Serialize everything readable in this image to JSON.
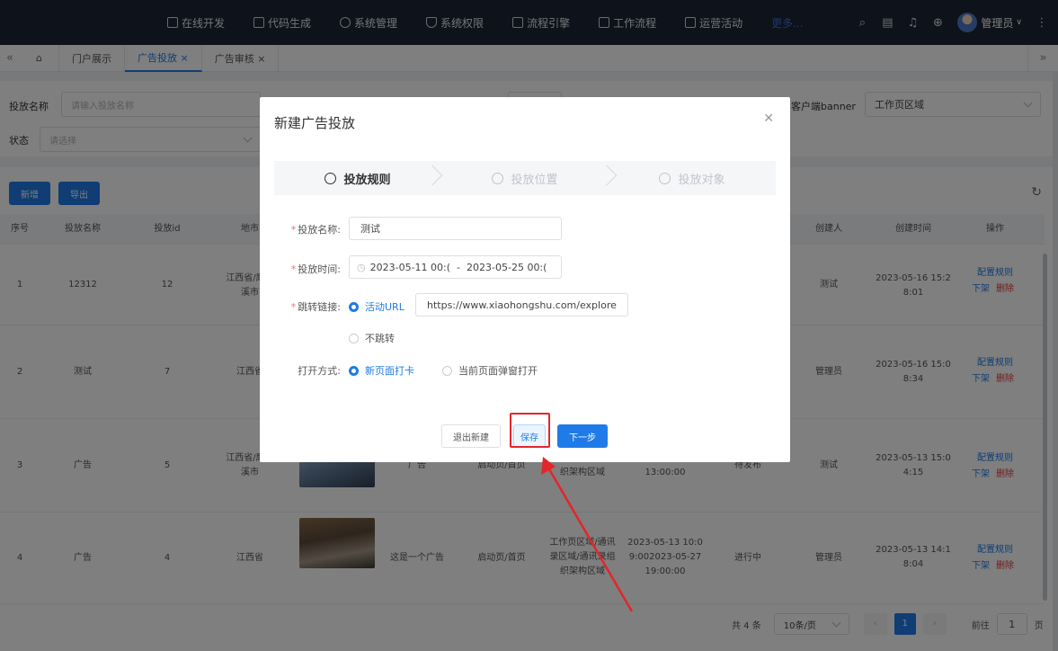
{
  "topnav": {
    "menu": [
      {
        "label": "在线开发",
        "icon": "monitor-icon"
      },
      {
        "label": "代码生成",
        "icon": "code-icon"
      },
      {
        "label": "系统管理",
        "icon": "gear-icon"
      },
      {
        "label": "系统权限",
        "icon": "shield-icon"
      },
      {
        "label": "流程引擎",
        "icon": "flow-icon"
      },
      {
        "label": "工作流程",
        "icon": "workflow-icon"
      },
      {
        "label": "运营活动",
        "icon": "grid-icon"
      }
    ],
    "more": "更多...",
    "user": "管理员"
  },
  "tabs": {
    "items": [
      "门户展示",
      "广告投放 ×",
      "广告审核 ×"
    ],
    "active_index": 1
  },
  "filter": {
    "name_label": "投放名称",
    "name_placeholder": "请输入投放名称",
    "status_label": "状态",
    "status_placeholder": "请选择",
    "banner_label": "客户端banner",
    "banner_value": "工作页区域"
  },
  "toolbar": {
    "add": "新增",
    "export": "导出"
  },
  "table": {
    "headers": [
      "序号",
      "投放名称",
      "投放id",
      "地市",
      "创建人",
      "创建时间",
      "操作"
    ],
    "rows": [
      {
        "no": "1",
        "name": "12312",
        "id": "12",
        "city": "江西省/鹰潭\n溪市",
        "creator": "测试",
        "time": "2023-05-16 15:2\n8:01",
        "ops": [
          "配置规则",
          "下架",
          "删除"
        ]
      },
      {
        "no": "2",
        "name": "测试",
        "id": "7",
        "city": "江西省",
        "creator": "管理员",
        "time": "2023-05-16 15:0\n8:34",
        "ops": [
          "配置规则",
          "下架",
          "删除"
        ]
      },
      {
        "no": "3",
        "name": "广告",
        "id": "5",
        "city": "江西省/鹰潭\n溪市",
        "desc": "广告",
        "page": "启动页/首页",
        "region": "录区域/通讯录组\n织架构区域",
        "period": "0:002023-05-20\n13:00:00",
        "state": "待发布",
        "creator": "测试",
        "time": "2023-05-13 15:0\n4:15",
        "ops": [
          "配置规则",
          "下架",
          "删除"
        ]
      },
      {
        "no": "4",
        "name": "广告",
        "id": "4",
        "city": "江西省",
        "desc": "这是一个广告",
        "page": "启动页/首页",
        "region": "工作页区域/通讯\n录区域/通讯录组\n织架构区域",
        "period": "2023-05-13 10:0\n9:002023-05-27\n19:00:00",
        "state": "进行中",
        "creator": "管理员",
        "time": "2023-05-13 14:1\n8:04",
        "ops": [
          "配置规则",
          "下架",
          "删除"
        ]
      }
    ]
  },
  "pager": {
    "total": "共 4 条",
    "size": "10条/页",
    "page": "1",
    "goto": "前往",
    "goto_value": "1",
    "unit": "页"
  },
  "modal": {
    "title": "新建广告投放",
    "steps": [
      "投放规则",
      "投放位置",
      "投放对象"
    ],
    "active_step": 0,
    "form": {
      "name_label": "投放名称:",
      "name_value": "测试",
      "time_label": "投放时间:",
      "time_start": "2023-05-11 00:(",
      "time_sep": "-",
      "time_end": "2023-05-25 00:(",
      "link_label": "跳转链接:",
      "link_opt1": "活动URL",
      "link_url": "https://www.xiaohongshu.com/explore",
      "link_opt2": "不跳转",
      "open_label": "打开方式:",
      "open_opt1": "新页面打卡",
      "open_opt2": "当前页面弹窗打开"
    },
    "buttons": {
      "exit": "退出新建",
      "save": "保存",
      "next": "下一步"
    }
  },
  "colors": {
    "primary": "#1f7be8",
    "danger": "#e4393c",
    "nav_bg": "#1c2434",
    "highlight": "#e2262b"
  }
}
